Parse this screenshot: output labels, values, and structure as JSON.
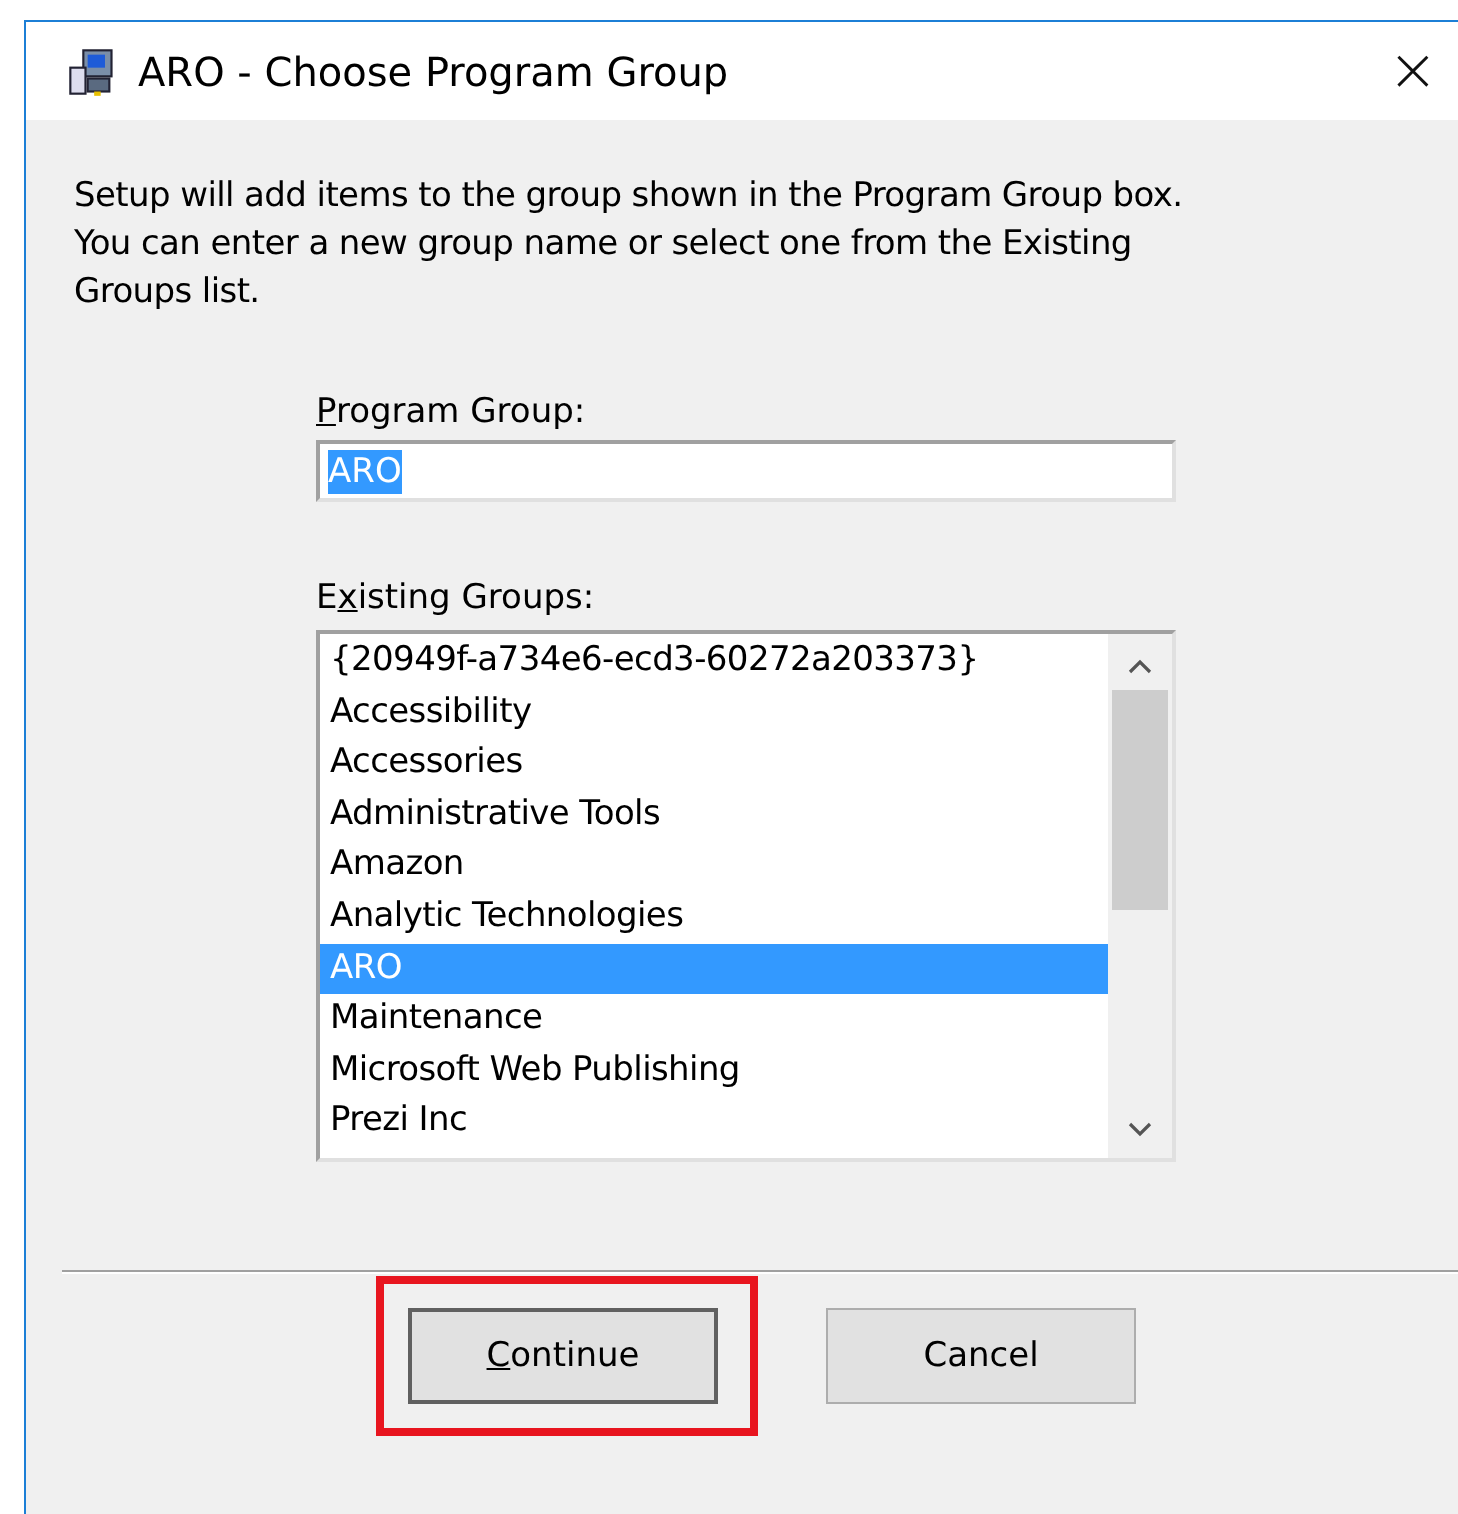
{
  "window": {
    "title": "ARO - Choose Program Group",
    "close": "×"
  },
  "description": "Setup will add items to the group shown in the Program Group box. You can enter a new group name or select one from the Existing Groups list.",
  "program_group": {
    "label": {
      "key": "P",
      "after": "rogram Group:"
    },
    "value": "ARO",
    "value_selected": true
  },
  "existing_groups": {
    "label": {
      "before": "E",
      "key": "x",
      "after": "isting Groups:"
    },
    "items": [
      {
        "text": "{20949f-a734e6-ecd3-60272a203373}",
        "selected": false
      },
      {
        "text": "Accessibility",
        "selected": false
      },
      {
        "text": "Accessories",
        "selected": false
      },
      {
        "text": "Administrative Tools",
        "selected": false
      },
      {
        "text": "Amazon",
        "selected": false
      },
      {
        "text": "Analytic Technologies",
        "selected": false
      },
      {
        "text": "ARO",
        "selected": true
      },
      {
        "text": "Maintenance",
        "selected": false
      },
      {
        "text": "Microsoft Web Publishing",
        "selected": false
      },
      {
        "text": "Prezi Inc",
        "selected": false
      }
    ]
  },
  "buttons": [
    {
      "label": {
        "key": "C",
        "after": "ontinue"
      },
      "default": true,
      "highlighted": true
    },
    {
      "label": {
        "before": "Cancel"
      },
      "default": false,
      "highlighted": false
    }
  ]
}
